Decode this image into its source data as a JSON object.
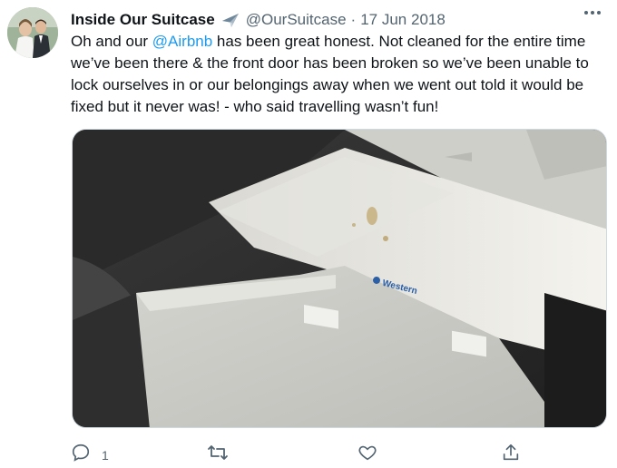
{
  "tweet": {
    "author": {
      "display_name": "Inside Our Suitcase",
      "badge_icon": "airplane-icon",
      "handle": "@OurSuitcase"
    },
    "separator": "·",
    "date": "17 Jun 2018",
    "text_before": "Oh and our ",
    "mention": "@Airbnb",
    "text_after": " has been great honest. Not cleaned for the entire time we’ve been there & the front door has been broken so we’ve been unable to lock ourselves in or our belongings away when we went out told it would be fixed but it never was! - who said travelling wasn’t fun!",
    "photo_brand_text": "Western",
    "actions": {
      "reply_count": "1"
    }
  },
  "colors": {
    "text": "#0f1419",
    "secondary": "#536471",
    "link": "#1d9bf0"
  }
}
